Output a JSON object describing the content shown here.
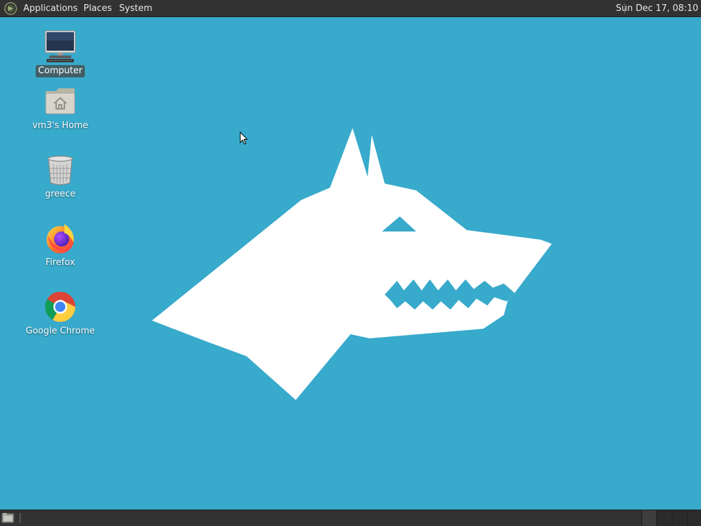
{
  "top_panel": {
    "menus": [
      "Applications",
      "Places",
      "System"
    ],
    "clock": "Sun Dec 17, 08:10"
  },
  "desktop": {
    "background_color": "#38aacb",
    "wallpaper_logo_color": "#ffffff",
    "icons": [
      {
        "label": "Computer",
        "icon": "computer-icon",
        "selected": true
      },
      {
        "label": "vm3's Home",
        "icon": "home-folder-icon",
        "selected": false
      },
      {
        "label": "greece",
        "icon": "trash-icon",
        "selected": false
      },
      {
        "label": "Firefox",
        "icon": "firefox-icon",
        "selected": false
      },
      {
        "label": "Google Chrome",
        "icon": "chrome-icon",
        "selected": false
      }
    ]
  },
  "bottom_panel": {
    "show_desktop_icon": "show-desktop-icon",
    "workspaces": 4,
    "active_workspace": 1
  }
}
